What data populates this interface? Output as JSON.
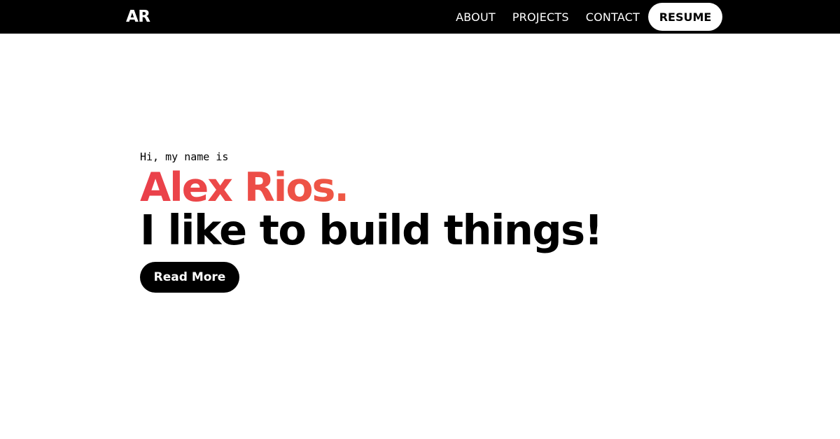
{
  "nav": {
    "logo": "AR",
    "links": [
      "ABOUT",
      "PROJECTS",
      "CONTACT"
    ],
    "resume_label": "RESUME"
  },
  "hero": {
    "greeting": "Hi, my name is",
    "name": "Alex Rios.",
    "tagline": "I like to build things!",
    "cta_label": "Read More"
  },
  "colors": {
    "nav_background": "#000000",
    "name_gradient_start": "#ea3f4a",
    "name_gradient_end": "#f4773e"
  }
}
